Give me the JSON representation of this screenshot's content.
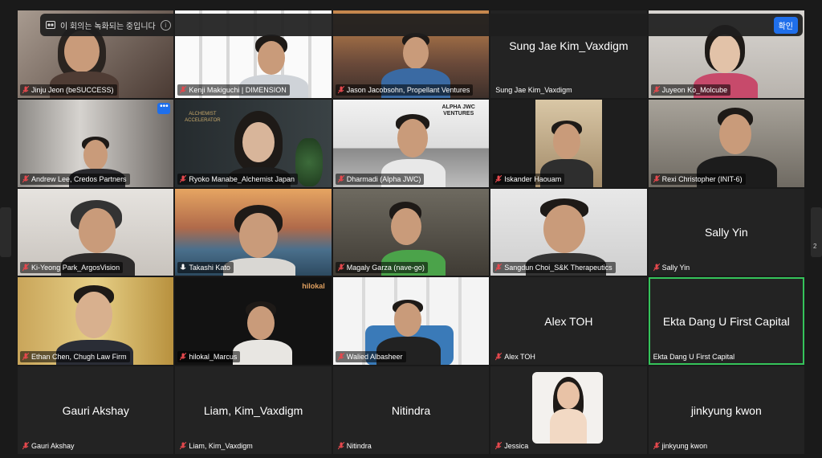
{
  "banner": {
    "text": "이 회의는 녹화되는 중입니다",
    "info_icon": "info-icon",
    "confirm_label": "확인",
    "accent": "#1f6feb"
  },
  "side_right_label": "2",
  "participants": [
    {
      "name": "Jinju Jeon (beSUCCESS)",
      "video": true,
      "muted": true
    },
    {
      "name": "Kenji Makiguchi | DIMENSION",
      "video": true,
      "muted": true
    },
    {
      "name": "Jason Jacobsohn, Propellant Ventures",
      "video": true,
      "muted": true
    },
    {
      "name": "Sung Jae Kim_Vaxdigm",
      "video": false,
      "muted": false,
      "display": "Sung Jae Kim_Vaxdigm"
    },
    {
      "name": "Juyeon Ko_Molcube",
      "video": true,
      "muted": true
    },
    {
      "name": "Andrew Lee, Credos Partners",
      "video": true,
      "muted": true
    },
    {
      "name": "Ryoko Manabe_Alchemist Japan",
      "video": true,
      "muted": true,
      "bg_text": "ALCHEMIST ACCELERATOR"
    },
    {
      "name": "Dharmadi (Alpha JWC)",
      "video": true,
      "muted": true,
      "bg_text": "ALPHA JWC VENTURES"
    },
    {
      "name": "Iskander Haouam",
      "video": true,
      "muted": true
    },
    {
      "name": "Rexi Christopher (INIT-6)",
      "video": true,
      "muted": true
    },
    {
      "name": "Ki-Yeong Park_ArgosVision",
      "video": true,
      "muted": true
    },
    {
      "name": "Takashi Kato",
      "video": true,
      "muted": false
    },
    {
      "name": "Magaly Garza (nave-go)",
      "video": true,
      "muted": true
    },
    {
      "name": "Sangdun Choi_S&K Therapeutics",
      "video": true,
      "muted": true
    },
    {
      "name": "Sally Yin",
      "video": false,
      "muted": true,
      "display": "Sally Yin"
    },
    {
      "name": "Ethan Chen, Chugh Law Firm",
      "video": true,
      "muted": true
    },
    {
      "name": "hilokal_Marcus",
      "video": true,
      "muted": true,
      "bg_text": "hilokal"
    },
    {
      "name": "Walied Albasheer",
      "video": true,
      "muted": true
    },
    {
      "name": "Alex TOH",
      "video": false,
      "muted": true,
      "display": "Alex TOH"
    },
    {
      "name": "Ekta Dang U First Capital",
      "video": false,
      "muted": false,
      "display": "Ekta Dang U First Capital",
      "active": true
    },
    {
      "name": "Gauri Akshay",
      "video": false,
      "muted": true,
      "display": "Gauri Akshay"
    },
    {
      "name": "Liam, Kim_Vaxdigm",
      "video": false,
      "muted": true,
      "display": "Liam, Kim_Vaxdigm"
    },
    {
      "name": "Nitindra",
      "video": false,
      "muted": true,
      "display": "Nitindra"
    },
    {
      "name": "Jessica",
      "video": false,
      "muted": true,
      "photo": true
    },
    {
      "name": "jinkyung kwon",
      "video": false,
      "muted": true,
      "display": "jinkyung kwon"
    }
  ]
}
